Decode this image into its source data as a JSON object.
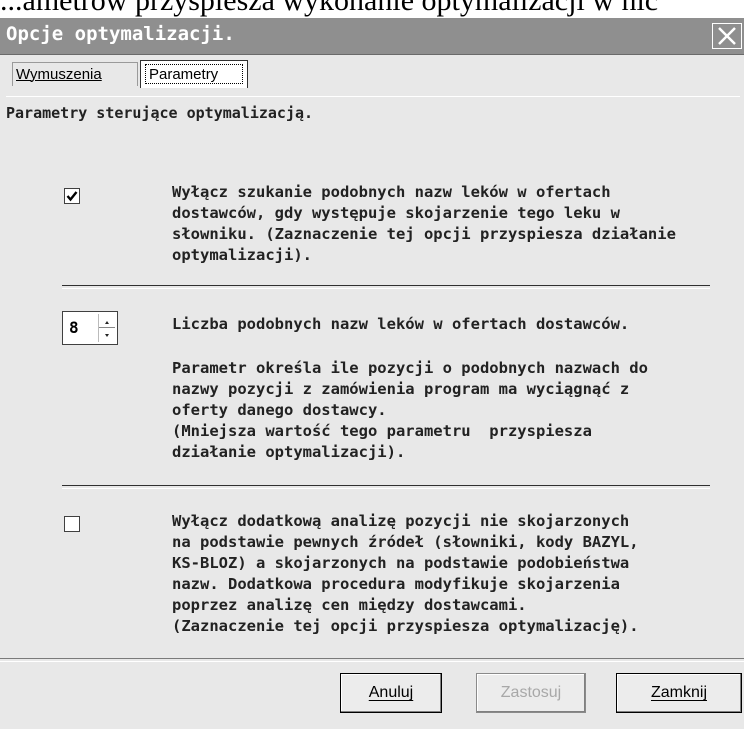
{
  "background_text": "...ametrów przyspiesza wykonanie optymalizacji w nic",
  "window": {
    "title": "Opcje optymalizacji.",
    "close_icon": "close-icon"
  },
  "tabs": [
    {
      "label": "Wymuszenia",
      "active": false
    },
    {
      "label": "Parametry",
      "active": true
    }
  ],
  "panel": {
    "subtitle": "Parametry sterujące optymalizacją.",
    "option1": {
      "checked": true,
      "text": "Wyłącz szukanie podobnych nazw leków w ofertach\ndostawców, gdy występuje skojarzenie tego leku w\nsłowniku. (Zaznaczenie tej opcji przyspiesza działanie\noptymalizacji)."
    },
    "option2": {
      "value": "8",
      "label": "Liczba podobnych nazw leków w ofertach dostawców.",
      "description": "Parametr określa ile pozycji o podobnych nazwach do\nnazwy pozycji z zamówienia program ma wyciągnąć z\noferty danego dostawcy.\n(Mniejsza wartość tego parametru  przyspiesza\ndziałanie optymalizacji)."
    },
    "option3": {
      "checked": false,
      "text": "Wyłącz dodatkową analizę pozycji nie skojarzonych\nna podstawie pewnych źródeł (słowniki, kody BAZYL,\nKS-BLOZ) a skojarzonych na podstawie podobieństwa\nnazw. Dodatkowa procedura modyfikuje skojarzenia\npoprzez analizę cen między dostawcami.\n(Zaznaczenie tej opcji przyspiesza optymalizację)."
    }
  },
  "buttons": {
    "cancel": "Anuluj",
    "apply": "Zastosuj",
    "close": "Zamknij"
  },
  "colors": {
    "titlebar": "#8f8f8f",
    "dialog_bg": "#e8e8e8",
    "disabled_text": "#a8a8a8"
  }
}
